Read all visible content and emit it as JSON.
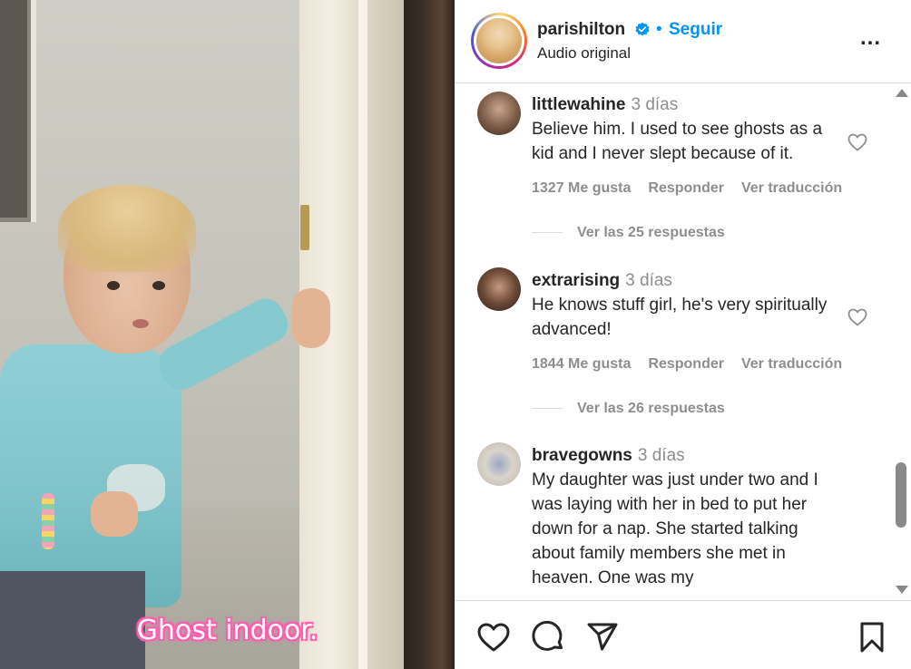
{
  "video": {
    "caption": "Ghost indoor."
  },
  "header": {
    "username": "parishilton",
    "verified_icon": "verified-badge-icon",
    "separator": "•",
    "follow_label": "Seguir",
    "audio_label": "Audio original",
    "more_label": "..."
  },
  "comments": [
    {
      "user": "littlewahine",
      "time": "3 días",
      "text": "Believe him. I used to see ghosts as a kid and I never slept because of it.",
      "likes": "1327 Me gusta",
      "reply_label": "Responder",
      "translate_label": "Ver traducción",
      "replies_label": "Ver las 25 respuestas"
    },
    {
      "user": "extrarising",
      "time": "3 días",
      "text": "He knows stuff girl, he's very spiritually advanced!",
      "likes": "1844 Me gusta",
      "reply_label": "Responder",
      "translate_label": "Ver traducción",
      "replies_label": "Ver las 26 respuestas"
    },
    {
      "user": "bravegowns",
      "time": "3 días",
      "text": "My daughter was just under two and I was laying with her in bed to put her down for a nap. She started talking about family members she met in heaven. One was my"
    }
  ],
  "icons": {
    "like": "heart-icon",
    "comment": "comment-icon",
    "share": "share-icon",
    "save": "bookmark-icon"
  },
  "colors": {
    "accent": "#0095f6",
    "muted": "#8e8e8e",
    "text": "#262626",
    "caption_glow": "#ff5db1"
  }
}
